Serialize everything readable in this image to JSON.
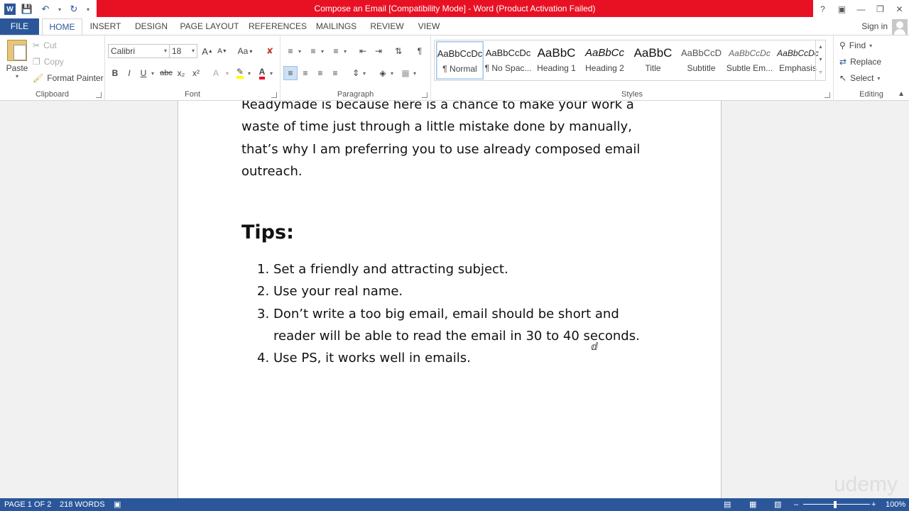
{
  "window": {
    "title": "Compose an Email [Compatibility Mode] - Word (Product Activation Failed)",
    "help": "?",
    "sign_in": "Sign in"
  },
  "tabs": [
    {
      "label": "FILE"
    },
    {
      "label": "HOME"
    },
    {
      "label": "INSERT"
    },
    {
      "label": "DESIGN"
    },
    {
      "label": "PAGE LAYOUT"
    },
    {
      "label": "REFERENCES"
    },
    {
      "label": "MAILINGS"
    },
    {
      "label": "REVIEW"
    },
    {
      "label": "VIEW"
    }
  ],
  "clipboard": {
    "paste": "Paste",
    "cut": "Cut",
    "copy": "Copy",
    "format_painter": "Format Painter",
    "label": "Clipboard"
  },
  "font": {
    "name": "Calibri",
    "size": "18",
    "label": "Font",
    "bold": "B",
    "italic": "I",
    "underline": "U",
    "strike": "abc",
    "subscript": "x₂",
    "superscript": "x²",
    "grow": "A",
    "shrink": "A",
    "change_case": "Aa"
  },
  "paragraph": {
    "label": "Paragraph",
    "pilcrow": "¶"
  },
  "styles": {
    "label": "Styles",
    "items": [
      {
        "sample": "AaBbCcDc",
        "name": "¶ Normal"
      },
      {
        "sample": "AaBbCcDc",
        "name": "¶ No Spac..."
      },
      {
        "sample": "AaBbC",
        "name": "Heading 1"
      },
      {
        "sample": "AaBbCc",
        "name": "Heading 2"
      },
      {
        "sample": "AaBbC",
        "name": "Title"
      },
      {
        "sample": "AaBbCcD",
        "name": "Subtitle"
      },
      {
        "sample": "AaBbCcDc",
        "name": "Subtle Em..."
      },
      {
        "sample": "AaBbCcDc",
        "name": "Emphasis"
      }
    ]
  },
  "editing": {
    "find": "Find",
    "replace": "Replace",
    "select": "Select",
    "label": "Editing"
  },
  "document": {
    "paragraph_lines": [
      "Readymade is because here is a chance to make your work a",
      "waste of time just through a little mistake done by manually,",
      "that’s why I am preferring you to use already composed email",
      "outreach."
    ],
    "tips_heading": "Tips:",
    "tips": [
      {
        "num": "1.",
        "lines": [
          "Set a friendly and attracting subject."
        ]
      },
      {
        "num": "2.",
        "lines": [
          "Use your real name."
        ]
      },
      {
        "num": "3.",
        "lines": [
          "Don’t write a too big email, email should be short and",
          "reader will be able to read the email in 30 to 40 seconds."
        ]
      },
      {
        "num": "4.",
        "lines": [
          "Use PS, it works well in emails."
        ]
      }
    ],
    "watermark": "udemy"
  },
  "status": {
    "page": "PAGE 1 OF 2",
    "words": "218 WORDS",
    "zoom": "100%",
    "zoom_level_percent": 100
  },
  "colors": {
    "accent": "#2b579a",
    "title_alert": "#e81123"
  }
}
